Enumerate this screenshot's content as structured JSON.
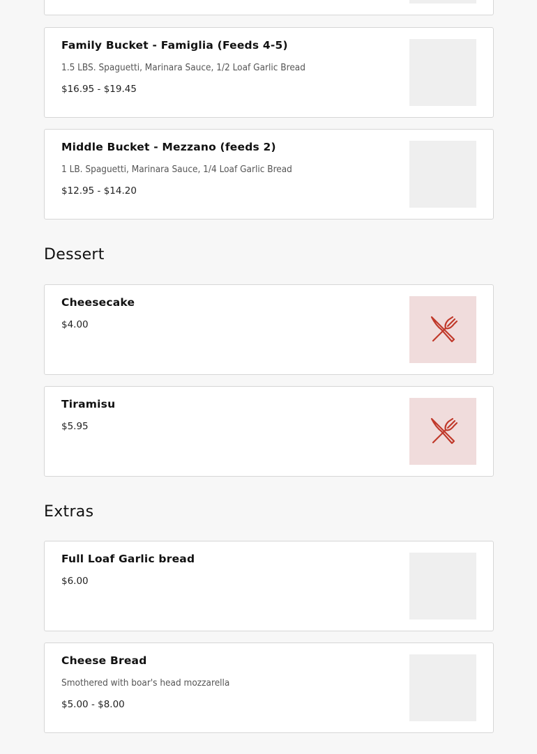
{
  "top_card": {},
  "items_pasta": [
    {
      "name": "Family Bucket - Famiglia (Feeds 4-5)",
      "description": "1.5 LBS. Spaguetti, Marinara Sauce, 1/2 Loaf Garlic Bread",
      "price": "$16.95 - $19.45"
    },
    {
      "name": "Middle Bucket - Mezzano (feeds 2)",
      "description": "1 LB. Spaguetti, Marinara Sauce, 1/4 Loaf Garlic Bread",
      "price": "$12.95 - $14.20"
    }
  ],
  "dessert": {
    "title": "Dessert",
    "items": [
      {
        "name": "Cheesecake",
        "price": "$4.00",
        "icon": "utensils-icon"
      },
      {
        "name": "Tiramisu",
        "price": "$5.95",
        "icon": "utensils-icon"
      }
    ]
  },
  "extras": {
    "title": "Extras",
    "items": [
      {
        "name": "Full Loaf Garlic bread",
        "price": "$6.00"
      },
      {
        "name": "Cheese Bread",
        "description": "Smothered with boar's head mozzarella",
        "price": "$5.00 - $8.00"
      }
    ]
  },
  "colors": {
    "placeholder_bg": "#f0dcdc",
    "icon": "#c0392b",
    "thumb_bg": "#efefef"
  }
}
